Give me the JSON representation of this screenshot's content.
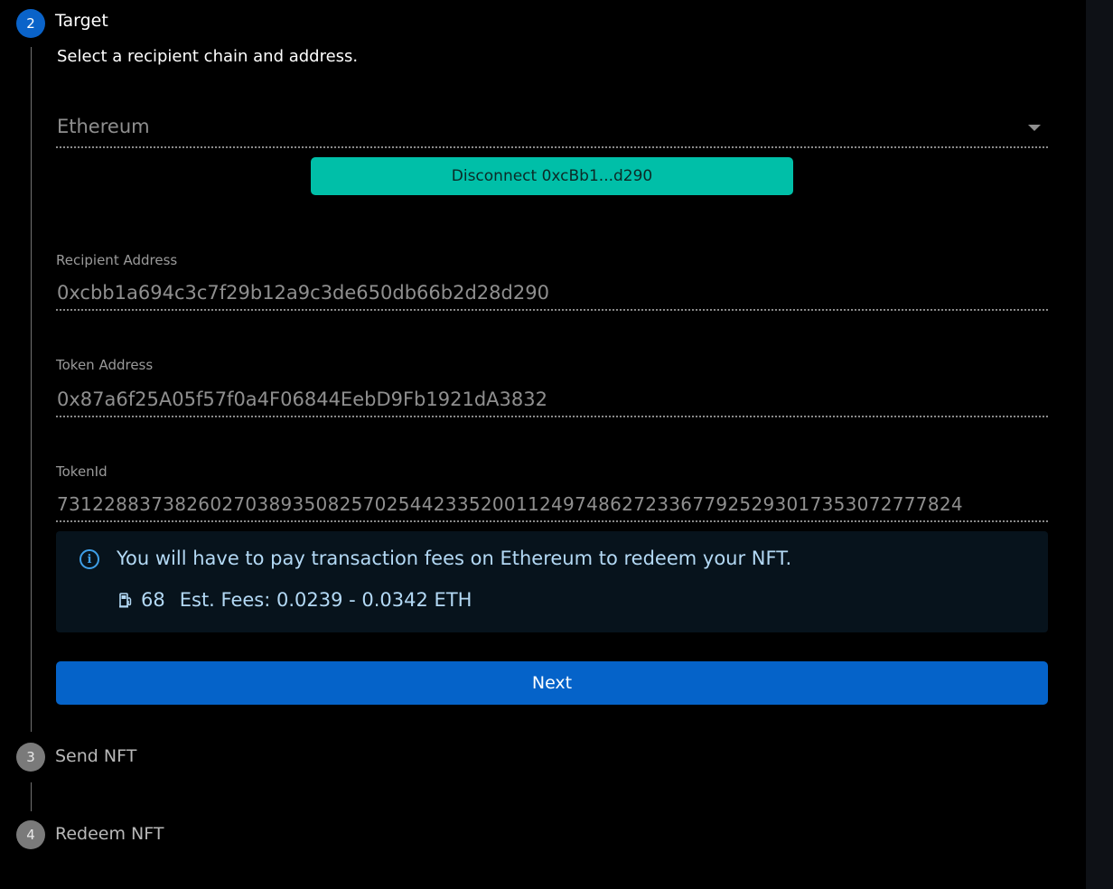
{
  "steps": {
    "target": {
      "number": "2",
      "title": "Target",
      "description": "Select a recipient chain and address."
    },
    "send": {
      "number": "3",
      "title": "Send NFT"
    },
    "redeem": {
      "number": "4",
      "title": "Redeem NFT"
    }
  },
  "chain_select": {
    "value": "Ethereum"
  },
  "wallet": {
    "disconnect_label": "Disconnect 0xcBb1...d290"
  },
  "recipient_address": {
    "label": "Recipient Address",
    "value": "0xcbb1a694c3c7f29b12a9c3de650db66b2d28d290"
  },
  "token_address": {
    "label": "Token Address",
    "value": "0x87a6f25A05f57f0a4F06844EebD9Fb1921dA3832"
  },
  "token_id": {
    "label": "TokenId",
    "value": "73122883738260270389350825702544233520011249748627233677925293017353072777824"
  },
  "fee_notice": {
    "message": "You will have to pay transaction fees on Ethereum to redeem your NFT.",
    "gas_price": "68",
    "estimate": "Est. Fees: 0.0239 - 0.0342 ETH"
  },
  "actions": {
    "next_label": "Next"
  },
  "colors": {
    "active_step": "#0a63c9",
    "inactive_step": "#7a7a7a",
    "disconnect_button": "#00bfa8",
    "next_button": "#0563c9",
    "info_text": "#b3d9f5",
    "info_icon": "#3f9fe8"
  },
  "icons": {
    "info": "info-circle-icon",
    "gas": "gas-pump-icon",
    "dropdown": "chevron-down-icon"
  }
}
